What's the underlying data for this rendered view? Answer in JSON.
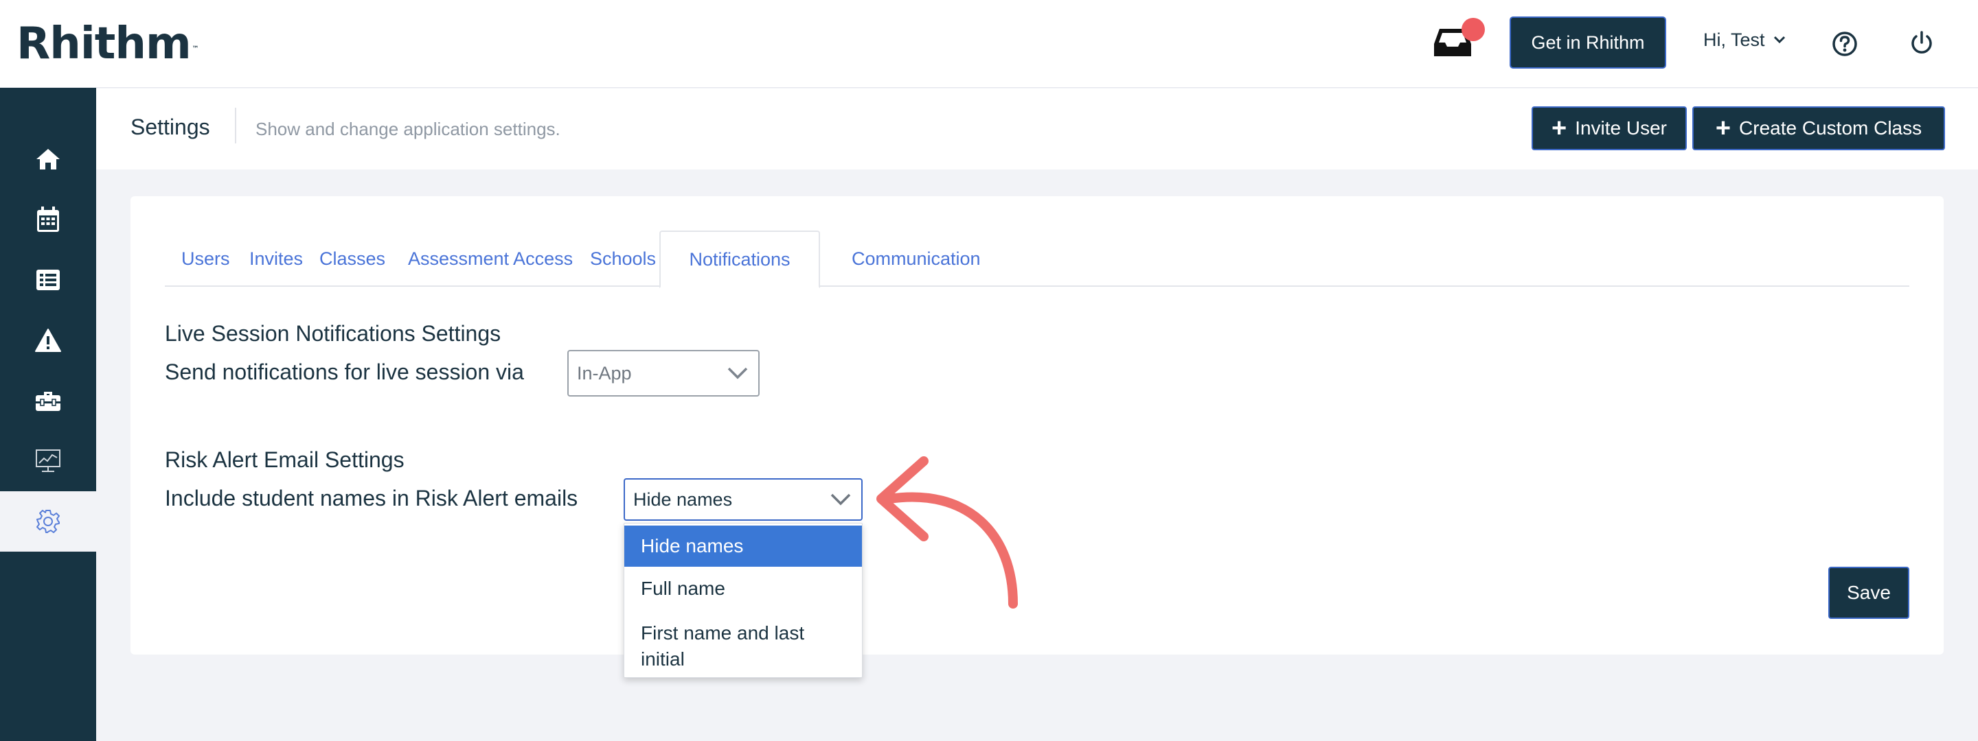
{
  "app": {
    "logo_text": "Rhithm",
    "logo_tm": "™"
  },
  "header": {
    "get_button_label": "Get in Rhithm",
    "user_menu_label": "Hi, Test",
    "colors": {
      "notification_dot": "#ee5b5f",
      "primary": "#173443",
      "accent_border": "#3b68c8"
    }
  },
  "sidebar": {
    "items": [
      {
        "icon": "home-icon",
        "active": false
      },
      {
        "icon": "calendar-icon",
        "active": false
      },
      {
        "icon": "list-icon",
        "active": false
      },
      {
        "icon": "warning-icon",
        "active": false
      },
      {
        "icon": "toolbox-icon",
        "active": false
      },
      {
        "icon": "monitor-chart-icon",
        "active": false
      },
      {
        "icon": "gear-icon",
        "active": true
      }
    ]
  },
  "page": {
    "title": "Settings",
    "subtitle": "Show and change application settings.",
    "invite_label": "Invite User",
    "custom_class_label": "Create Custom Class"
  },
  "tabs": [
    {
      "label": "Users",
      "active": false
    },
    {
      "label": "Invites",
      "active": false
    },
    {
      "label": "Classes",
      "active": false
    },
    {
      "label": "Assessment Access",
      "active": false
    },
    {
      "label": "Schools",
      "active": false
    },
    {
      "label": "Notifications",
      "active": true
    },
    {
      "label": "Communication",
      "active": false
    }
  ],
  "live_session": {
    "title": "Live Session Notifications Settings",
    "label": "Send notifications for live session via",
    "selected": "In-App"
  },
  "risk_alert": {
    "title": "Risk Alert Email Settings",
    "label": "Include student names in Risk Alert emails",
    "selected": "Hide names",
    "options": [
      "Hide names",
      "Full name",
      "First name and last",
      "initial"
    ]
  },
  "save_label": "Save",
  "annotation": {
    "arrow_color": "#ef6f6c"
  }
}
